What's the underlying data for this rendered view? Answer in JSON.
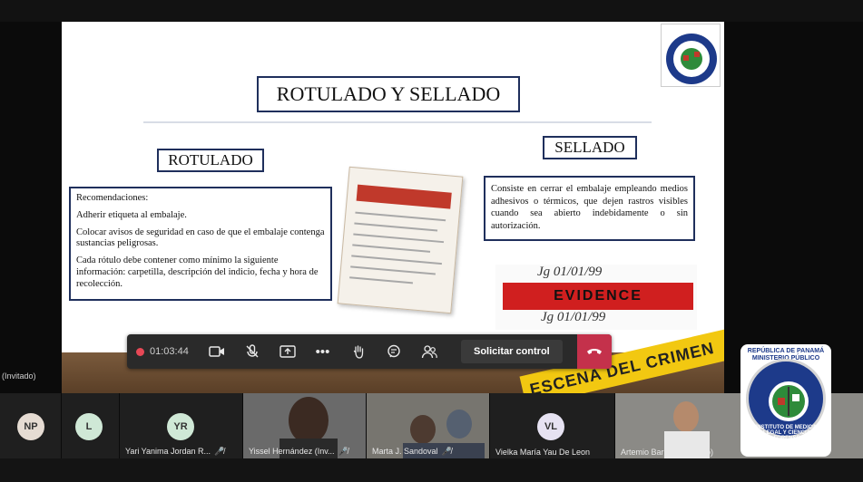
{
  "slide": {
    "title": "ROTULADO Y SELLADO",
    "rotulado_heading": "ROTULADO",
    "sellado_heading": "SELLADO",
    "recommendations": [
      "Recomendaciones:",
      "Adherir etiqueta al embalaje.",
      "Colocar avisos de seguridad en caso de que el embalaje contenga sustancias peligrosas.",
      "Cada rótulo debe contener como mínimo la siguiente información: carpetilla, descripción del indicio, fecha y hora de recolección."
    ],
    "sellado_text": "Consiste en cerrar el embalaje empleando medios adhesivos o térmicos, que dejen rastros visibles cuando sea abierto indebidamente o sin autorización.",
    "evidence_tape": "EVIDENCE",
    "evidence_date_top": "Jg 01/01/99",
    "evidence_date_bottom": "Jg 01/01/99",
    "crime_tape": "ESCENA DEL CRIMEN",
    "seal_top_lines": "REPÚBLICA DE PANAMÁ MINISTERIO PÚBLICO"
  },
  "controls": {
    "timer": "01:03:44",
    "request_control": "Solicitar control"
  },
  "invited_label": "(Invitado)",
  "participants": [
    {
      "initials": "NP",
      "name": "",
      "color": "#e6dcd3"
    },
    {
      "initials": "L",
      "name": "",
      "color": "#cfe8d6"
    },
    {
      "initials": "YR",
      "name": "Yari Yanima Jordan R...",
      "color": "#cfe8d6"
    },
    {
      "initials": "",
      "name": "Yissel Hernández (Inv...",
      "color": ""
    },
    {
      "initials": "",
      "name": "Marta J. Sandoval",
      "color": ""
    },
    {
      "initials": "VL",
      "name": "Vielka María Yau De Leon",
      "color": "#e6e2f2"
    },
    {
      "initials": "",
      "name": "Artemio Barrios (Invitado)",
      "color": ""
    }
  ],
  "institute_seal": {
    "top": "REPÚBLICA DE PANAMÁ MINISTERIO PÚBLICO",
    "ring": "INSTITUTO DE MEDICINA LEGAL Y CIENCIAS FORENSES"
  },
  "colors": {
    "accent_red": "#c4314b",
    "rec_dot": "#e74856",
    "control_bar": "#2a2a2a",
    "box_border": "#1f2f5c"
  }
}
